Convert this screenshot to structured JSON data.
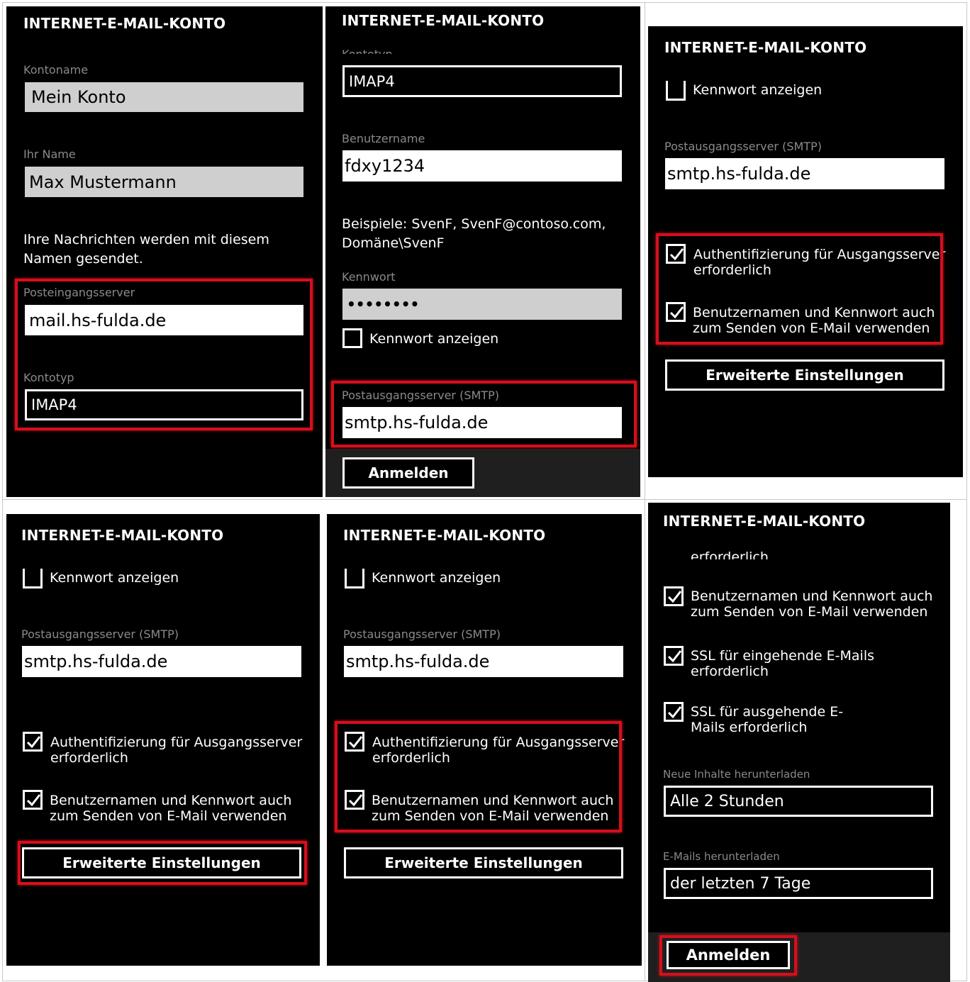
{
  "app_title": "INTERNET-E-MAIL-KONTO",
  "labels": {
    "kontoname": "Kontoname",
    "ihr_name": "Ihr Name",
    "posteingang": "Posteingangsserver",
    "kontotyp": "Kontotyp",
    "kontotyp_cut": "Kontotyp",
    "benutzername": "Benutzername",
    "kennwort": "Kennwort",
    "postausgang": "Postausgangsserver (SMTP)",
    "neue_inhalte": "Neue Inhalte herunterladen",
    "emails_herunterladen": "E-Mails herunterladen"
  },
  "values": {
    "kontoname": "Mein Konto",
    "ihr_name": "Max Mustermann",
    "posteingang": "mail.hs-fulda.de",
    "kontotyp": "IMAP4",
    "benutzername": "fdxy1234",
    "kennwort": "••••••••",
    "postausgang": "smtp.hs-fulda.de",
    "neue_inhalte": "Alle 2 Stunden",
    "emails_herunterladen": "der letzten 7 Tage"
  },
  "texts": {
    "name_hint": "Ihre Nachrichten werden mit diesem Namen gesendet.",
    "beispiele": "Beispiele: SvenF, SvenF@contoso.com, Domäne\\SvenF",
    "erforderlich_cut": "erforderlich"
  },
  "checkboxes": {
    "kennwort_anzeigen": "Kennwort anzeigen",
    "auth_ausgang": "Authentifizierung für Ausgangsserver erforderlich",
    "benutzer_kennwort": "Benutzernamen und Kennwort auch zum Senden von E-Mail verwenden",
    "ssl_eingehend": "SSL für eingehende E-Mails erforderlich",
    "ssl_ausgehend": "SSL für ausgehende E-Mails erforderlich"
  },
  "buttons": {
    "anmelden": "Anmelden",
    "erweitert": "Erweiterte Einstellungen"
  },
  "colors": {
    "highlight": "#d50f1c",
    "screen": "#000000",
    "label": "#8a8a8a"
  }
}
